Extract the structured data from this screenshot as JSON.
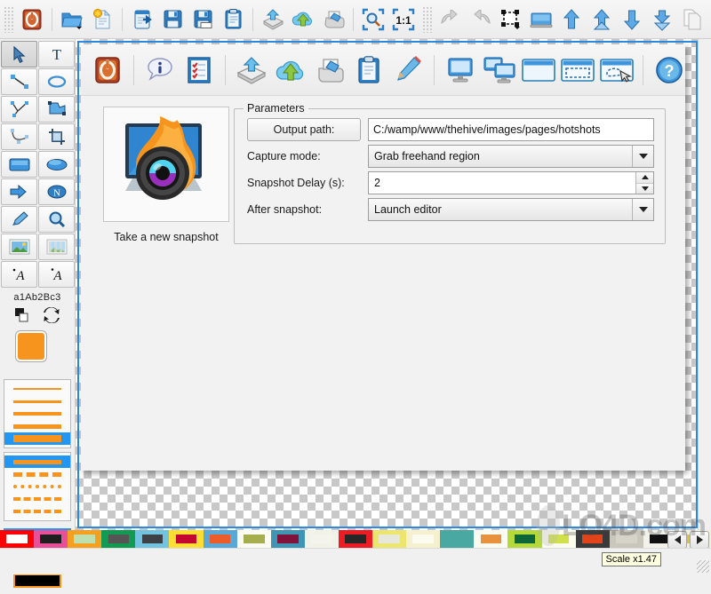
{
  "app": {
    "name": "HotShots"
  },
  "main_toolbar": {
    "groups": [
      {
        "items": [
          {
            "icon": "power-quit-icon",
            "label": "Quit"
          }
        ]
      },
      {
        "items": [
          {
            "icon": "open-folder-icon",
            "label": "Open"
          },
          {
            "icon": "new-document-icon",
            "label": "New"
          }
        ]
      },
      {
        "items": [
          {
            "icon": "export-icon",
            "label": "Export"
          },
          {
            "icon": "save-icon",
            "label": "Save"
          },
          {
            "icon": "save-as-icon",
            "label": "Save As"
          },
          {
            "icon": "clipboard-icon",
            "label": "Copy to clipboard"
          }
        ]
      },
      {
        "items": [
          {
            "icon": "upload-box-icon",
            "label": "Upload"
          },
          {
            "icon": "cloud-upload-icon",
            "label": "Upload to cloud"
          },
          {
            "icon": "print-icon",
            "label": "Print"
          }
        ]
      },
      {
        "items": [
          {
            "icon": "zoom-fit-icon",
            "label": "Fit to window"
          },
          {
            "icon": "zoom-actual-icon",
            "label": "1:1"
          }
        ]
      },
      {
        "items": [
          {
            "icon": "undo-icon",
            "label": "Undo"
          },
          {
            "icon": "redo-icon",
            "label": "Redo"
          },
          {
            "icon": "transform-icon",
            "label": "Transform"
          },
          {
            "icon": "screen-icon",
            "label": "Screen"
          },
          {
            "icon": "arrow-up-icon",
            "label": "Raise"
          },
          {
            "icon": "arrow-up-top-icon",
            "label": "Raise to top"
          },
          {
            "icon": "arrow-down-icon",
            "label": "Lower"
          },
          {
            "icon": "arrow-down-bottom-icon",
            "label": "Lower to bottom"
          },
          {
            "icon": "duplicate-icon",
            "label": "Duplicate"
          },
          {
            "icon": "trash-icon",
            "label": "Delete"
          },
          {
            "icon": "close-x-icon",
            "label": "Close"
          }
        ]
      }
    ],
    "zoom_label": "1:1"
  },
  "tools_panel": {
    "tools": [
      {
        "icon": "cursor-select-icon",
        "label": "Select",
        "selected": true
      },
      {
        "icon": "text-tool-icon",
        "label": "Text"
      },
      {
        "icon": "line-tool-icon",
        "label": "Line"
      },
      {
        "icon": "ellipse-outline-icon",
        "label": "Ellipse outline"
      },
      {
        "icon": "polyline-tool-icon",
        "label": "Polyline"
      },
      {
        "icon": "polygon-tool-icon",
        "label": "Polygon"
      },
      {
        "icon": "curve-tool-icon",
        "label": "Curve"
      },
      {
        "icon": "crop-tool-icon",
        "label": "Crop"
      },
      {
        "icon": "rectangle-tool-icon",
        "label": "Rectangle"
      },
      {
        "icon": "filled-ellipse-tool-icon",
        "label": "Filled ellipse"
      },
      {
        "icon": "arrow-tool-icon",
        "label": "Arrow"
      },
      {
        "icon": "numbering-tool-icon",
        "label": "Numbering"
      },
      {
        "icon": "highlighter-tool-icon",
        "label": "Highlighter"
      },
      {
        "icon": "magnifier-tool-icon",
        "label": "Magnifier"
      },
      {
        "icon": "image-insert-icon",
        "label": "Insert image"
      },
      {
        "icon": "blur-tool-icon",
        "label": "Blur"
      },
      {
        "icon": "text-style-a-icon",
        "label": "Text style"
      },
      {
        "icon": "text-style-italic-icon",
        "label": "Italic text style"
      }
    ],
    "font_sample": "a1Ab2Bc3",
    "fgbg": {
      "reset_icon": "reset-colors-icon",
      "swap_icon": "swap-colors-icon",
      "foreground": "#f7941e",
      "background": "#111111"
    },
    "line_widths": [
      1,
      2,
      3,
      4,
      6
    ],
    "selected_line_width_index": 4,
    "line_styles": [
      "solid",
      "dash-long",
      "dash-short",
      "dash-dot",
      "dash-medium"
    ],
    "selected_line_style_index": 0,
    "fill_styles": [
      {
        "name": "none",
        "fill": "#ffffff"
      },
      {
        "name": "gray",
        "fill": "#9d9d9d"
      },
      {
        "name": "black",
        "fill": "#000000"
      }
    ],
    "selected_fill_index": 0
  },
  "inner_toolbar": {
    "groups": [
      {
        "items": [
          {
            "icon": "power-quit-icon",
            "label": "Quit"
          }
        ]
      },
      {
        "items": [
          {
            "icon": "about-info-icon",
            "label": "About"
          },
          {
            "icon": "checklist-icon",
            "label": "Preferences"
          }
        ]
      },
      {
        "items": [
          {
            "icon": "upload-box-icon",
            "label": "Upload"
          },
          {
            "icon": "cloud-upload-icon",
            "label": "Upload to cloud"
          },
          {
            "icon": "print-icon",
            "label": "Print"
          },
          {
            "icon": "clipboard-icon",
            "label": "Clipboard"
          },
          {
            "icon": "pencil-edit-icon",
            "label": "Edit"
          }
        ]
      },
      {
        "items": [
          {
            "icon": "capture-screen-icon",
            "label": "Grab screen"
          },
          {
            "icon": "capture-dual-screen-icon",
            "label": "Grab all screens"
          },
          {
            "icon": "capture-window-icon",
            "label": "Grab window"
          },
          {
            "icon": "capture-region-icon",
            "label": "Grab rectangular region"
          },
          {
            "icon": "capture-freehand-icon",
            "label": "Grab freehand region"
          }
        ]
      },
      {
        "items": [
          {
            "icon": "help-question-icon",
            "label": "Help"
          }
        ]
      }
    ]
  },
  "snapshot": {
    "logo_icon": "hotshots-logo-icon",
    "caption": "Take a new snapshot"
  },
  "parameters": {
    "legend": "Parameters",
    "output_path": {
      "button_label": "Output path:",
      "value": "C:/wamp/www/thehive/images/pages/hotshots"
    },
    "capture_mode": {
      "label": "Capture mode:",
      "value": "Grab freehand region",
      "options": [
        "Grab screen",
        "Grab all screens",
        "Grab window",
        "Grab rectangular region",
        "Grab freehand region"
      ]
    },
    "snapshot_delay": {
      "label": "Snapshot Delay (s):",
      "value": "2"
    },
    "after_snapshot": {
      "label": "After snapshot:",
      "value": "Launch editor",
      "options": [
        "Launch editor",
        "Copy to clipboard",
        "Save to file"
      ]
    }
  },
  "palette": {
    "swatches": [
      {
        "outer": "#ff0000",
        "inner": "#ffffff"
      },
      {
        "outer": "#e8519a",
        "inner": "#1f1f1f"
      },
      {
        "outer": "#f5a01e",
        "inner": "#bde0ae"
      },
      {
        "outer": "#119a52",
        "inner": "#555555"
      },
      {
        "outer": "#72c3e0",
        "inner": "#3b4147"
      },
      {
        "outer": "#ffdd33",
        "inner": "#c4072f"
      },
      {
        "outer": "#5aa8d8",
        "inner": "#ec5b2a"
      },
      {
        "outer": "#fbfbf4",
        "inner": "#a5ad4f"
      },
      {
        "outer": "#3f96b4",
        "inner": "#81123c"
      },
      {
        "outer": "#f2f2e9",
        "inner": "#f4f4ec"
      },
      {
        "outer": "#ec1c24",
        "inner": "#272727"
      },
      {
        "outer": "#ece56e",
        "inner": "#e8e8da"
      },
      {
        "outer": "#f5f0cd",
        "inner": "#fbfbef"
      },
      {
        "outer": "#4aa8a2",
        "inner": "#4aa8a2"
      },
      {
        "outer": "#fbfbf2",
        "inner": "#e8913f"
      },
      {
        "outer": "#b3d93b",
        "inner": "#0c6638"
      },
      {
        "outer": "#fbfbee",
        "inner": "#cfe04a"
      },
      {
        "outer": "#3a3a3a",
        "inner": "#e2441a"
      },
      {
        "outer": "#c9c7bb",
        "inner": "#d6d4c8"
      },
      {
        "outer": "#f2f2ea",
        "inner": "#101010"
      },
      {
        "outer": "#f0f0df",
        "inner": "#d7c33c"
      }
    ],
    "nav_prev_icon": "palette-prev-icon",
    "nav_next_icon": "palette-next-icon"
  },
  "status": {
    "scale_tooltip": "Scale x1.47"
  },
  "watermark": {
    "text": "LO4D.com"
  }
}
